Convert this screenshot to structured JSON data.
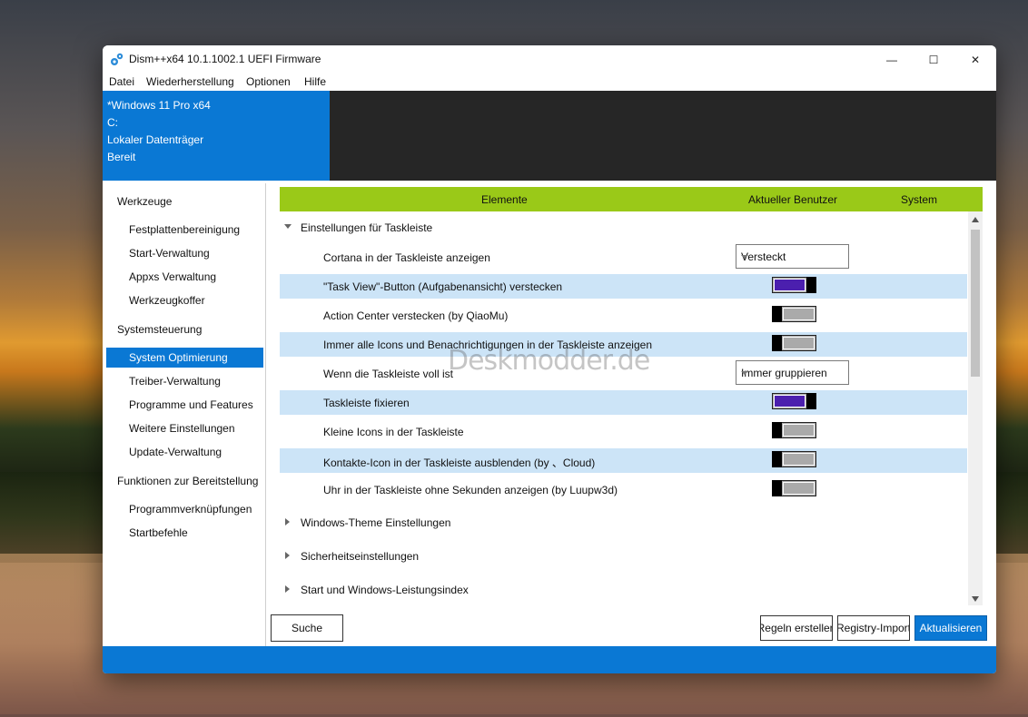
{
  "window": {
    "title": "Dism++x64 10.1.1002.1 UEFI Firmware",
    "minimize_glyph": "—",
    "maximize_glyph": "☐",
    "close_glyph": "✕"
  },
  "menu": [
    "Datei",
    "Wiederherstellung",
    "Optionen",
    "Hilfe"
  ],
  "info": {
    "os": "*Windows 11 Pro x64",
    "drive": "C:",
    "volume": "Lokaler Datenträger",
    "status": "Bereit"
  },
  "sidebar": {
    "sections": [
      {
        "label": "Werkzeuge",
        "items": [
          "Festplattenbereinigung",
          "Start-Verwaltung",
          "Appxs Verwaltung",
          "Werkzeugkoffer"
        ]
      },
      {
        "label": "Systemsteuerung",
        "items": [
          "System Optimierung",
          "Treiber-Verwaltung",
          "Programme und Features",
          "Weitere Einstellungen",
          "Update-Verwaltung"
        ]
      },
      {
        "label": "Funktionen zur Bereitstellung",
        "items": [
          "Programmverknüpfungen",
          "Startbefehle"
        ]
      }
    ],
    "selected": "System Optimierung"
  },
  "table": {
    "headers": [
      "Elemente",
      "Aktueller Benutzer",
      "System"
    ],
    "expanded_group": "Einstellungen für Taskleiste",
    "rows": [
      {
        "label": "Cortana in der Taskleiste anzeigen",
        "control": "dropdown",
        "value": "Versteckt"
      },
      {
        "label": "\"Task View\"-Button (Aufgabenansicht) verstecken",
        "control": "toggle",
        "value": "on"
      },
      {
        "label": "Action Center verstecken (by QiaoMu)",
        "control": "toggle",
        "value": "off"
      },
      {
        "label": "Immer alle Icons und Benachrichtigungen in der Taskleiste anzeigen",
        "control": "toggle",
        "value": "off"
      },
      {
        "label": "Wenn die Taskleiste voll ist",
        "control": "dropdown",
        "value": "Immer gruppieren"
      },
      {
        "label": "Taskleiste fixieren",
        "control": "toggle",
        "value": "on"
      },
      {
        "label": "Kleine Icons in der Taskleiste",
        "control": "toggle",
        "value": "off"
      },
      {
        "label": "Kontakte-Icon in der Taskleiste ausblenden (by 、Cloud)",
        "control": "toggle",
        "value": "off"
      },
      {
        "label": "Uhr in der Taskleiste ohne Sekunden anzeigen (by Luupw3d)",
        "control": "toggle",
        "value": "off"
      }
    ],
    "collapsed_groups": [
      "Windows-Theme Einstellungen",
      "Sicherheitseinstellungen",
      "Start und Windows-Leistungsindex"
    ]
  },
  "buttons": {
    "search": "Suche",
    "create_rules": "Regeln erstellen",
    "registry_import": "Registry-Import",
    "refresh": "Aktualisieren"
  },
  "watermark": "Deskmodder.de",
  "colors": {
    "accent": "#0a78d4",
    "header_green": "#9ac918",
    "toggle_on": "#4b1fae",
    "row_highlight": "#cce4f7"
  }
}
